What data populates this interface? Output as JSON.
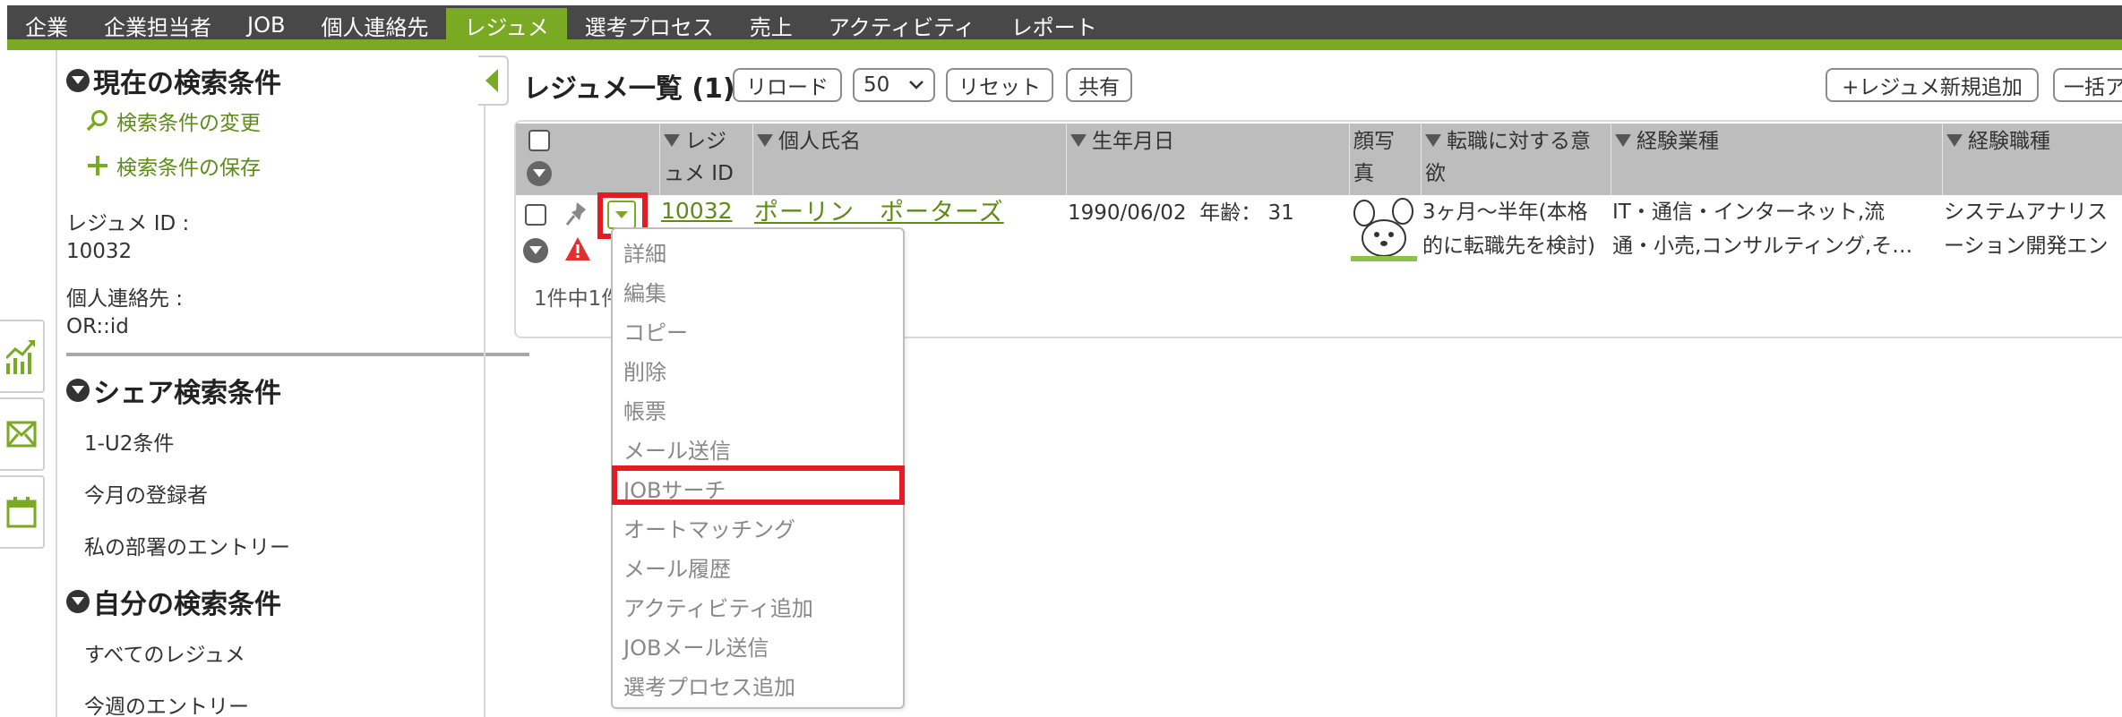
{
  "nav": {
    "items": [
      "企業",
      "企業担当者",
      "JOB",
      "個人連絡先",
      "レジュメ",
      "選考プロセス",
      "売上",
      "アクティビティ",
      "レポート"
    ],
    "active_index": 4,
    "bar_color": "#484848",
    "accent_color": "#7aa923"
  },
  "side_tabs": [
    {
      "icon": "chart-icon"
    },
    {
      "icon": "mail-icon"
    },
    {
      "icon": "calendar-icon"
    }
  ],
  "sidebar": {
    "current": {
      "title": "現在の検索条件",
      "change_link": "検索条件の変更",
      "save_link": "検索条件の保存",
      "resume_id_label": "レジュメ ID :",
      "resume_id_value": "10032",
      "contact_label": "個人連絡先 :",
      "contact_value": "OR::id"
    },
    "shared": {
      "title": "シェア検索条件",
      "items": [
        "1-U2条件",
        "今月の登録者",
        "私の部署のエントリー"
      ]
    },
    "mine": {
      "title": "自分の検索条件",
      "items": [
        "すべてのレジュメ",
        "今週のエントリー"
      ]
    }
  },
  "main": {
    "title": "レジュメ一覧 (1)",
    "buttons": {
      "reload": "リロード",
      "per_page": "50",
      "reset": "リセット",
      "share": "共有",
      "add_new": "+レジュメ新規追加",
      "bulk": "一括ア"
    },
    "columns": {
      "resume_id": [
        "▼レジ",
        "ュメ ID"
      ],
      "name": "▼個人氏名",
      "birth": "▼生年月日",
      "photo": [
        "顔写",
        "真"
      ],
      "motivation": [
        "▼転職に対する意",
        "欲"
      ],
      "industry": "▼経験業種",
      "job_type": "▼経験職種"
    },
    "row": {
      "resume_id": "10032",
      "name": "ポーリン　ポーターズ",
      "birth": "1990/06/02",
      "age_label": "年齢：",
      "age": "31",
      "motivation": [
        "3ヶ月〜半年(本格",
        "的に転職先を検討)"
      ],
      "industry": [
        "IT・通信・インターネット,流",
        "通・小売,コンサルティング,そ…"
      ],
      "job_type": [
        "システムアナリス",
        "ーション開発エン"
      ]
    },
    "pager_text": "1件中1件"
  },
  "menu": {
    "items": [
      "詳細",
      "編集",
      "コピー",
      "削除",
      "帳票",
      "メール送信",
      "JOBサーチ",
      "オートマッチング",
      "メール履歴",
      "アクティビティ追加",
      "JOBメール送信",
      "選考プロセス追加"
    ],
    "highlighted_index": 6
  },
  "highlight_color": "#e11c24"
}
